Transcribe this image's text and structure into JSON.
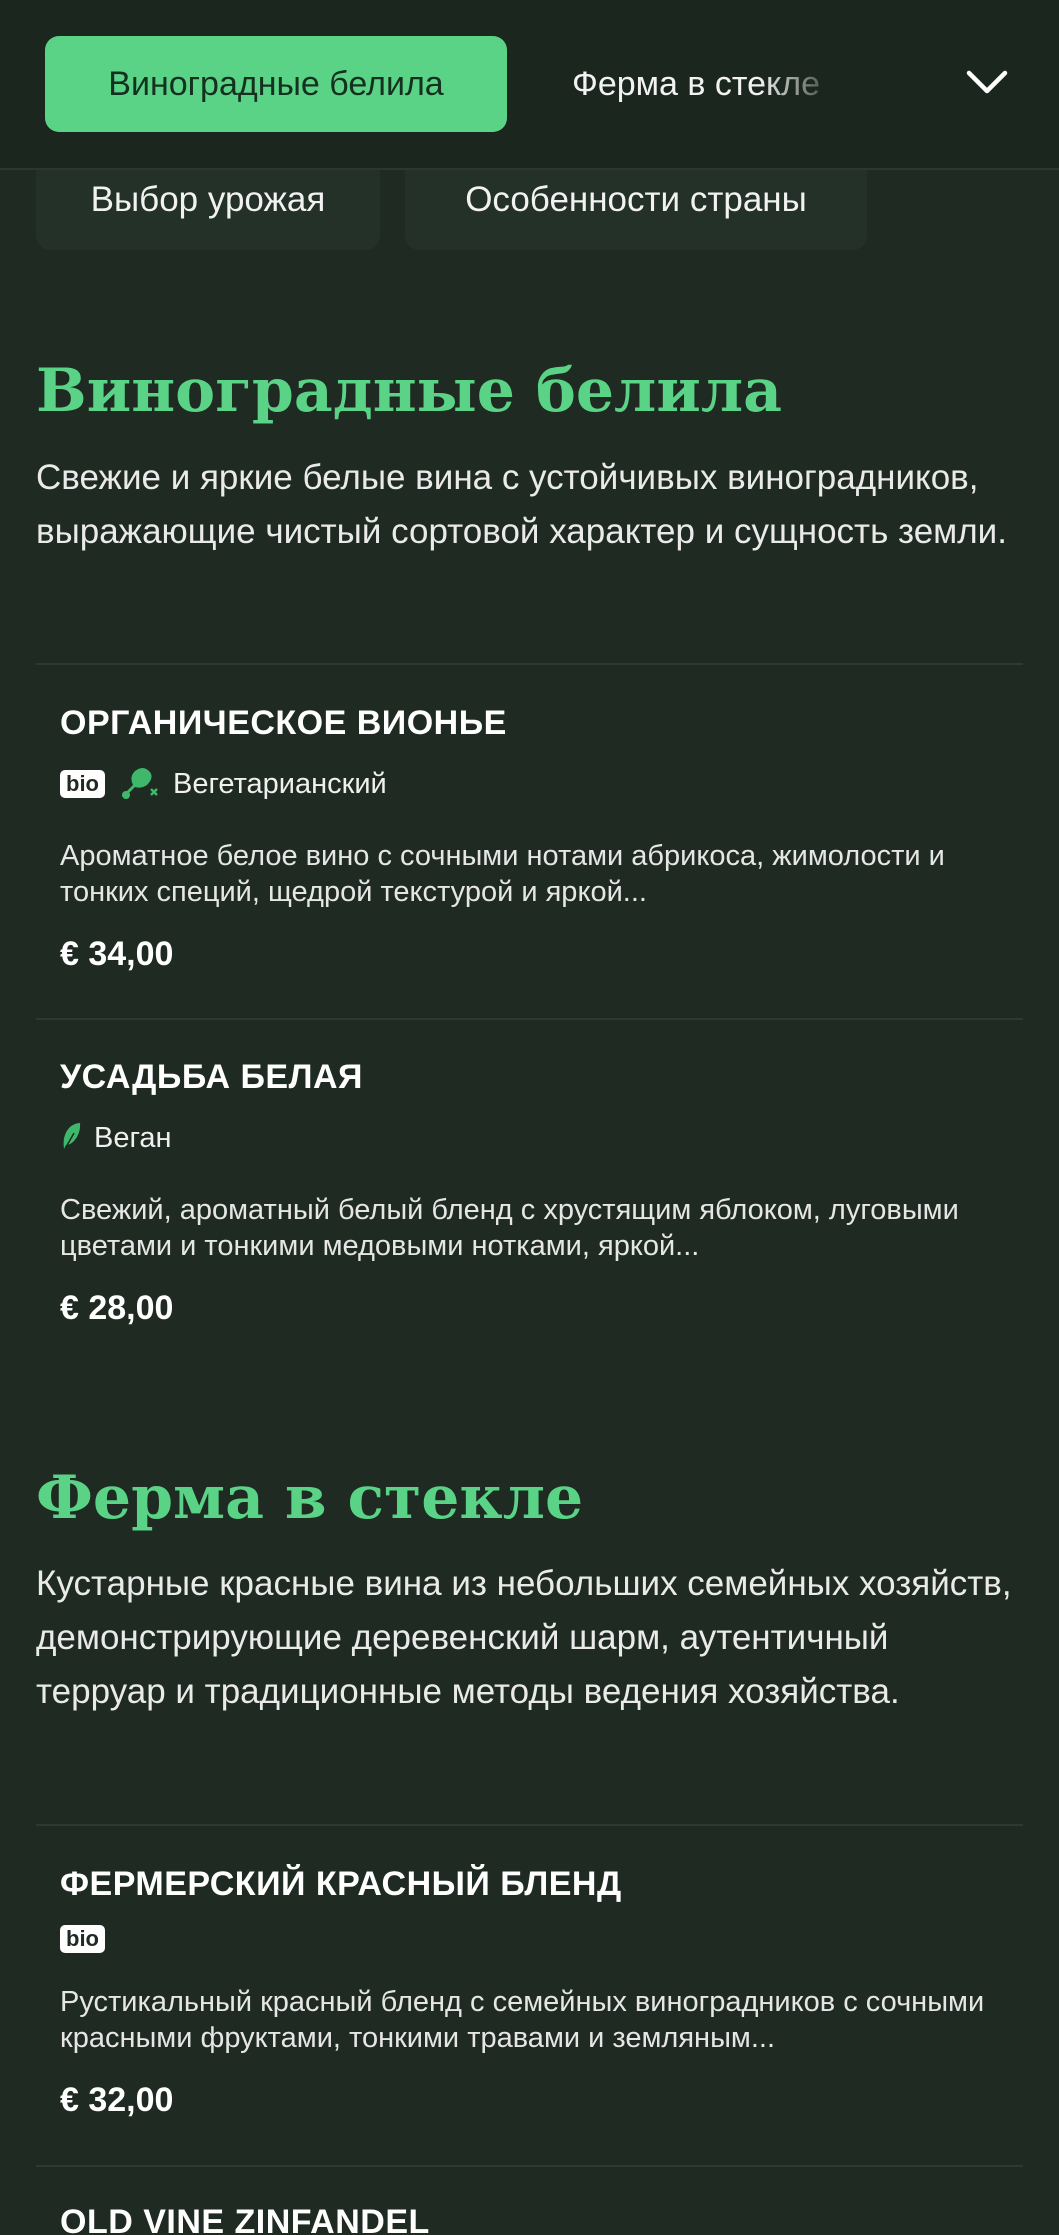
{
  "nav": {
    "active_tab": "Виноградные белила",
    "next_tab": "Ферма в стекле"
  },
  "filters": [
    "Выбор урожая",
    "Особенности страны"
  ],
  "sections": [
    {
      "title": "Виноградные белила",
      "description": "Свежие и яркие белые вина с устойчивых виноградников, выражающие чистый сортовой характер и сущность земли.",
      "items": [
        {
          "name": "ОРГАНИЧЕСКОЕ ВИОНЬЕ",
          "bio": "bio",
          "tag": "Вегетарианский",
          "description": "Ароматное белое вино с сочными нотами абрикоса, жимолости и тонких специй, щедрой текстурой и яркой...",
          "price": "€ 34,00"
        },
        {
          "name": "УСАДЬБА БЕЛАЯ",
          "tag": "Веган",
          "description": "Свежий, ароматный белый бленд с хрустящим яблоком, луговыми цветами и тонкими медовыми нотками, яркой...",
          "price": "€ 28,00"
        }
      ]
    },
    {
      "title": "Ферма в стекле",
      "description": "Кустарные красные вина из небольших семейных хозяйств, демонстрирующие деревенский шарм, аутентичный терруар и традиционные методы ведения хозяйства.",
      "items": [
        {
          "name": "ФЕРМЕРСКИЙ КРАСНЫЙ БЛЕНД",
          "bio": "bio",
          "description": "Рустикальный красный бленд с семейных виноградников с сочными красными фруктами, тонкими травами и земляным...",
          "price": "€ 32,00"
        },
        {
          "name": "OLD VINE ZINFANDEL"
        }
      ]
    }
  ],
  "colors": {
    "background": "#1e2a22",
    "accent": "#5bd387",
    "chip": "#243128"
  }
}
